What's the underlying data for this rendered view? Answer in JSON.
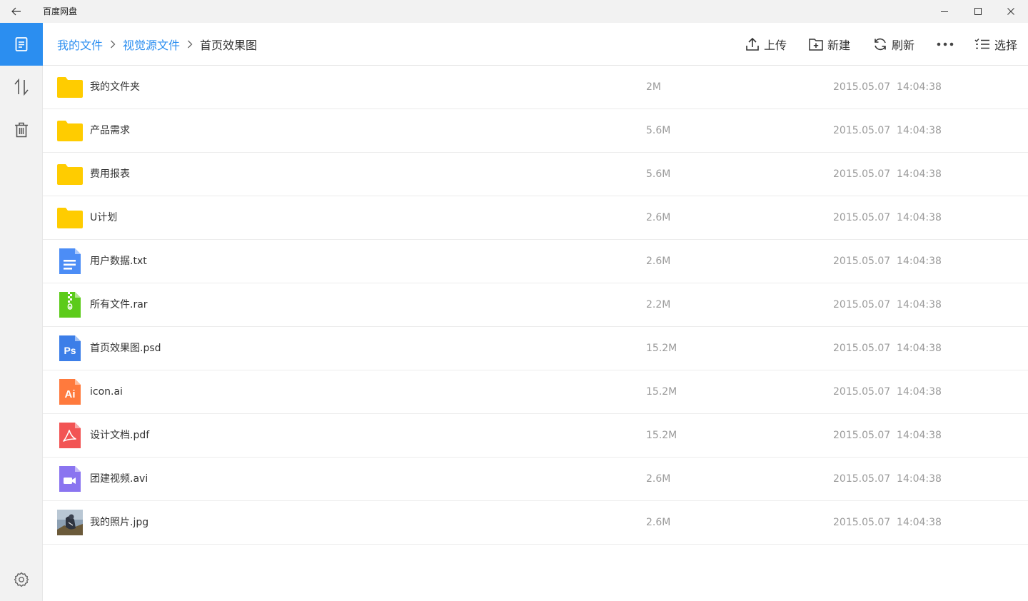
{
  "app": {
    "title": "百度网盘"
  },
  "window_controls": {
    "back_icon": "arrow-left-icon",
    "minimize_icon": "minimize-icon",
    "maximize_icon": "maximize-icon",
    "close_icon": "close-icon"
  },
  "sidebar": {
    "items": [
      {
        "name": "files",
        "icon": "document-icon",
        "active": true
      },
      {
        "name": "transfers",
        "icon": "transfer-arrows-icon",
        "active": false
      },
      {
        "name": "trash",
        "icon": "trash-icon",
        "active": false
      }
    ],
    "settings_icon": "gear-icon"
  },
  "breadcrumb": {
    "items": [
      "我的文件",
      "视觉源文件"
    ],
    "current": "首页效果图"
  },
  "toolbar": {
    "upload_label": "上传",
    "new_label": "新建",
    "refresh_label": "刷新",
    "more_icon": "more-dots-icon",
    "select_label": "选择"
  },
  "colors": {
    "accent": "#2b8ef0",
    "folder": "#ffcc00",
    "txt": "#4c8df6",
    "rar": "#5ccb1a",
    "psd": "#3c7ee8",
    "ai": "#ff7a3d",
    "pdf": "#f25454",
    "avi": "#8a74f0"
  },
  "files": [
    {
      "name": "我的文件夹",
      "type": "folder",
      "size": "2M",
      "date": "2015.05.07  14:04:38"
    },
    {
      "name": "产品需求",
      "type": "folder",
      "size": "5.6M",
      "date": "2015.05.07  14:04:38"
    },
    {
      "name": "费用报表",
      "type": "folder",
      "size": "5.6M",
      "date": "2015.05.07  14:04:38"
    },
    {
      "name": "U计划",
      "type": "folder",
      "size": "2.6M",
      "date": "2015.05.07  14:04:38"
    },
    {
      "name": "用户数据.txt",
      "type": "txt",
      "size": "2.6M",
      "date": "2015.05.07  14:04:38"
    },
    {
      "name": "所有文件.rar",
      "type": "rar",
      "size": "2.2M",
      "date": "2015.05.07  14:04:38"
    },
    {
      "name": "首页效果图.psd",
      "type": "psd",
      "size": "15.2M",
      "date": "2015.05.07  14:04:38",
      "badge": "Ps"
    },
    {
      "name": "icon.ai",
      "type": "ai",
      "size": "15.2M",
      "date": "2015.05.07  14:04:38",
      "badge": "Ai"
    },
    {
      "name": "设计文档.pdf",
      "type": "pdf",
      "size": "15.2M",
      "date": "2015.05.07  14:04:38"
    },
    {
      "name": "团建视频.avi",
      "type": "avi",
      "size": "2.6M",
      "date": "2015.05.07  14:04:38"
    },
    {
      "name": "我的照片.jpg",
      "type": "jpg",
      "size": "2.6M",
      "date": "2015.05.07  14:04:38"
    }
  ]
}
